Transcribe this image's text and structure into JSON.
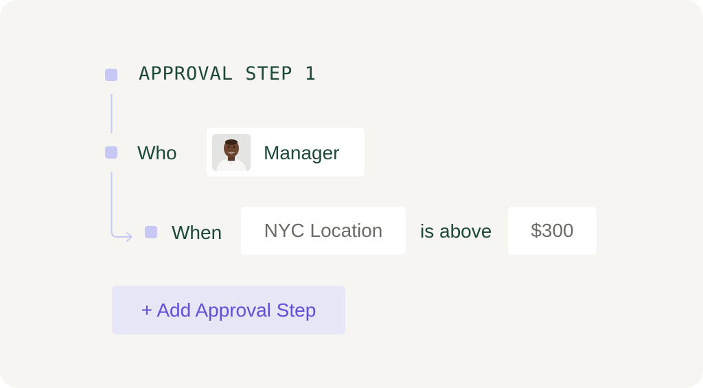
{
  "approval_step": {
    "title": "APPROVAL STEP 1"
  },
  "who": {
    "label": "Who",
    "approver": {
      "role": "Manager",
      "avatar_icon": "person-avatar-icon"
    }
  },
  "when": {
    "label": "When",
    "location": "NYC Location",
    "operator": "is above",
    "amount": "$300"
  },
  "add_step_button": {
    "label": "+ Add Approval Step"
  },
  "colors": {
    "background": "#f6f5f1",
    "text_green": "#1b4a35",
    "bullet": "#c7c8f4",
    "button_bg": "#e7e6f6",
    "button_text": "#5f4fd9"
  }
}
